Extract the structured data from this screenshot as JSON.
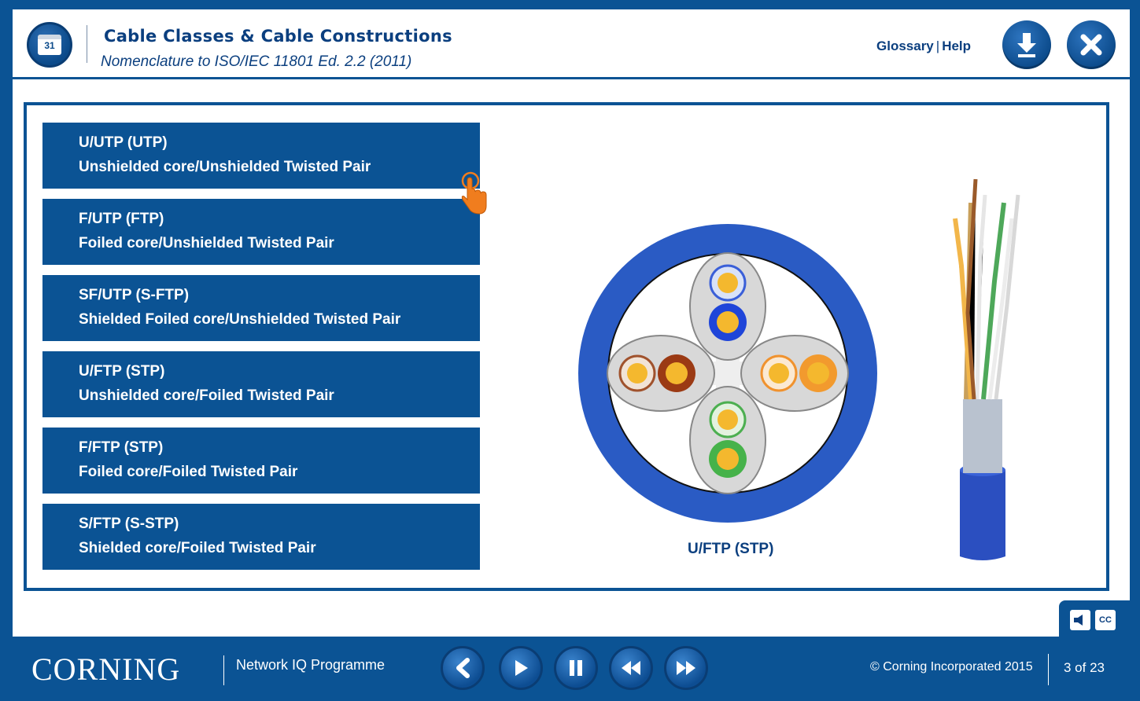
{
  "header": {
    "title": "Cable Classes & Cable Constructions",
    "subtitle": "Nomenclature to ISO/IEC 11801 Ed. 2.2 (2011)",
    "calendar_day": "31",
    "glossary_label": "Glossary",
    "help_label": "Help",
    "pipe": "|"
  },
  "options": [
    {
      "code": "U/UTP (UTP)",
      "desc": "Unshielded core/Unshielded Twisted Pair"
    },
    {
      "code": "F/UTP (FTP)",
      "desc": "Foiled core/Unshielded Twisted Pair"
    },
    {
      "code": "SF/UTP (S-FTP)",
      "desc": "Shielded Foiled core/Unshielded Twisted Pair"
    },
    {
      "code": "U/FTP (STP)",
      "desc": "Unshielded core/Foiled Twisted Pair"
    },
    {
      "code": "F/FTP (STP)",
      "desc": "Foiled core/Foiled Twisted Pair"
    },
    {
      "code": "S/FTP (S-STP)",
      "desc": "Shielded core/Foiled Twisted Pair"
    }
  ],
  "illustration": {
    "caption": "U/FTP (STP)"
  },
  "media": {
    "cc_label": "CC"
  },
  "footer": {
    "logo": "CORNING",
    "programme": "Network IQ Programme",
    "copyright": "© Corning Incorporated 2015",
    "page_indicator": "3 of 23"
  },
  "colors": {
    "brand_blue": "#0b5394",
    "title_blue": "#0b3f7f",
    "jacket_blue": "#2a5bc4",
    "cursor_orange": "#f07d1e"
  }
}
